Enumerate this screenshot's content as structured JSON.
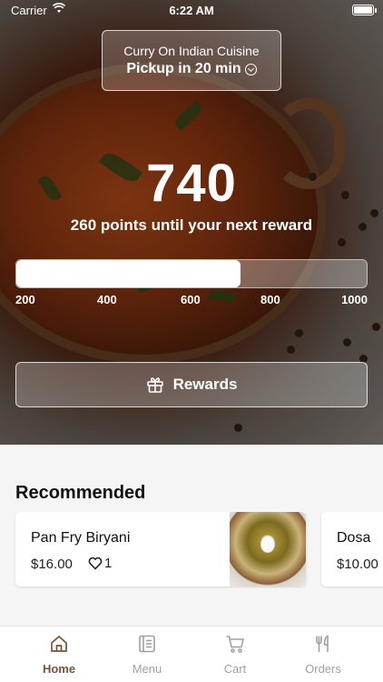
{
  "status_bar": {
    "carrier": "Carrier",
    "time": "6:22 AM"
  },
  "store": {
    "name": "Curry On Indian Cuisine",
    "pickup": "Pickup in 20 min"
  },
  "rewards": {
    "points": "740",
    "until_text": "260 points until your next reward",
    "progress_fraction": 0.64,
    "ticks": [
      "200",
      "400",
      "600",
      "800",
      "1000"
    ],
    "button_label": "Rewards"
  },
  "recommended": {
    "title": "Recommended",
    "items": [
      {
        "name": "Pan Fry Biryani",
        "price": "$16.00",
        "likes": "1"
      },
      {
        "name": "Dosa",
        "price": "$10.00"
      }
    ]
  },
  "tabs": [
    {
      "label": "Home",
      "icon": "home-icon",
      "active": true
    },
    {
      "label": "Menu",
      "icon": "menu-icon",
      "active": false
    },
    {
      "label": "Cart",
      "icon": "cart-icon",
      "active": false
    },
    {
      "label": "Orders",
      "icon": "orders-icon",
      "active": false
    }
  ],
  "colors": {
    "accent": "#7a5335",
    "tab_inactive": "#a0a0a0"
  }
}
